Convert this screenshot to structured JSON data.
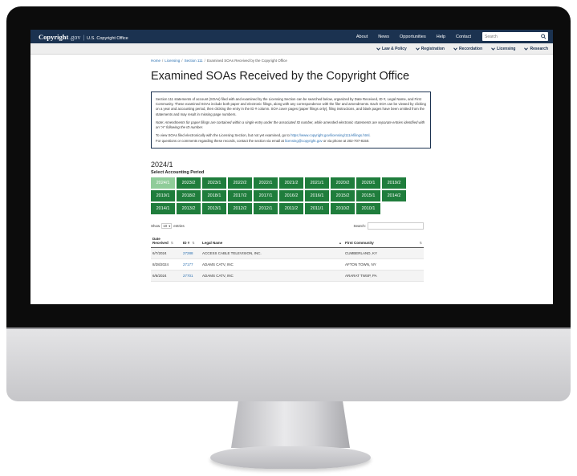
{
  "site": {
    "logo_mark": "Copyright",
    "logo_gov": ".gov",
    "logo_sep": "|",
    "logo_office": "U.S. Copyright Office"
  },
  "topnav": [
    "About",
    "News",
    "Opportunities",
    "Help",
    "Contact"
  ],
  "search": {
    "placeholder": "Search"
  },
  "subnav": [
    "Law & Policy",
    "Registration",
    "Recordation",
    "Licensing",
    "Research"
  ],
  "breadcrumb": [
    "Home",
    "Licensing",
    "Section 111",
    "Examined SOAs Received by the Copyright Office"
  ],
  "page_title": "Examined SOAs Received by the Copyright Office",
  "intro": {
    "p1": "Section 111 statements of account (SOAs) filed with and examined by the Licensing Section can be searched below, organized by Date Received, ID #, Legal Name, and First Community. These examined SOAs include both paper and electronic filings, along with any correspondence with the filer and amendments. Each SOA can be viewed by clicking on a year and accounting period, then clicking the entry in the ID # column. SOA cover pages (paper filings only), filing instructions, and blank pages have been omitted from the statements and may result in missing page numbers.",
    "note": "Note: Amendments for paper filings are contained within a single entry under the associated ID number, while amended electronic statements are separate entries identified with an \"A\" following the ID number.",
    "p3_text": "To view SOAs filed electronically with the Licensing Section, but not yet examined, go to",
    "p3_link": "https://www.copyright.gov/licensing/111/efilings.html",
    "p3_end": ".",
    "p4_text": "For questions or comments regarding these records, contact the section via email at",
    "p4_email": "licensing@copyright.gov",
    "p4_end": "or via phone at 202-707-8150."
  },
  "period": {
    "heading": "2024/1",
    "label": "Select Accounting Period",
    "active": "2024/1",
    "buttons": [
      "2024/1",
      "2023/2",
      "2023/1",
      "2022/2",
      "2022/1",
      "2021/2",
      "2021/1",
      "2020/2",
      "2020/1",
      "2019/2",
      "2019/1",
      "2018/2",
      "2018/1",
      "2017/2",
      "2017/1",
      "2016/2",
      "2016/1",
      "2015/2",
      "2015/1",
      "2014/2",
      "2014/1",
      "2013/2",
      "2013/1",
      "2012/2",
      "2012/1",
      "2011/2",
      "2011/1",
      "2010/2",
      "2010/1"
    ]
  },
  "table": {
    "show_label": "Show",
    "length_value": "10",
    "entries_label": "entries",
    "search_label": "Search:",
    "headers": {
      "date_line1": "Date",
      "date_line2": "Received",
      "id": "ID #",
      "legal_name": "Legal Name",
      "first_community": "First Community"
    },
    "rows": [
      {
        "date": "6/7/2024",
        "id": "27288",
        "name": "ACCESS CABLE TELEVISION, INC.",
        "community": "CUMBERLAND, KY"
      },
      {
        "date": "8/28/2024",
        "id": "27177",
        "name": "ADAMS CATV, INC",
        "community": "AFTON TOWN, NY"
      },
      {
        "date": "6/6/2024",
        "id": "27701",
        "name": "ADAMS CATV, INC",
        "community": "ARARAT TWSP, PA"
      }
    ]
  },
  "colors": {
    "header_navy": "#1b3250",
    "period_green": "#1f7d3c",
    "period_active": "#8fcc99",
    "link_blue": "#2a6fb0"
  }
}
